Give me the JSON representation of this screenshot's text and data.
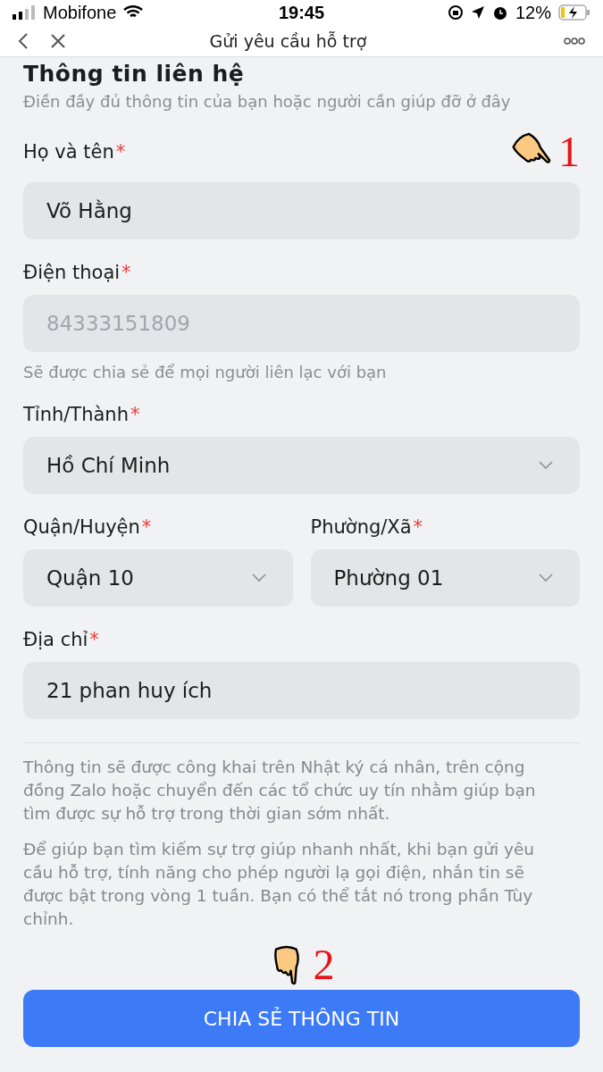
{
  "status_bar": {
    "carrier": "Mobifone",
    "time": "19:45",
    "battery": "12%"
  },
  "nav": {
    "title": "Gửi yêu cầu hỗ trợ"
  },
  "section": {
    "title": "Thông tin liên hệ",
    "subtitle": "Điền đầy đủ thông tin của bạn hoặc người cần giúp đỡ ở đây"
  },
  "fields": [
    {
      "kind": "text",
      "label": "Họ và tên",
      "required": true,
      "mark": "*",
      "value": "Võ Hằng",
      "disabled": false
    },
    {
      "kind": "text",
      "label": "Điện thoại",
      "required": true,
      "mark": "*",
      "value": "84333151809",
      "disabled": true,
      "hint": "Sẽ được chia sẻ để mọi người liên lạc với bạn"
    },
    {
      "kind": "select",
      "label": "Tỉnh/Thành",
      "required": true,
      "mark": "*",
      "value": "Hồ Chí Minh"
    },
    {
      "kind": "pair",
      "items": [
        {
          "label": "Quận/Huyện",
          "required": true,
          "mark": "*",
          "value": "Quận 10"
        },
        {
          "label": "Phường/Xã",
          "required": true,
          "mark": "*",
          "value": "Phường 01"
        }
      ]
    },
    {
      "kind": "text",
      "label": "Địa chỉ",
      "required": true,
      "mark": "*",
      "value": "21 phan huy ích",
      "disabled": false
    }
  ],
  "notes": [
    "Thông tin sẽ được công khai trên Nhật ký cá nhân, trên cộng đồng Zalo hoặc chuyển đến các tổ chức uy tín nhằm giúp bạn tìm được sự hỗ trợ trong thời gian sớm nhất.",
    "Để giúp bạn tìm kiếm sự trợ giúp nhanh nhất, khi bạn gửi yêu cầu hỗ trợ, tính năng cho phép người lạ gọi điện, nhắn tin sẽ được bật trong vòng 1 tuần. Bạn có thể tắt nó trong phần Tùy chỉnh."
  ],
  "submit": "CHIA SẺ THÔNG TIN",
  "annotations": [
    {
      "number": "1"
    },
    {
      "number": "2"
    }
  ]
}
